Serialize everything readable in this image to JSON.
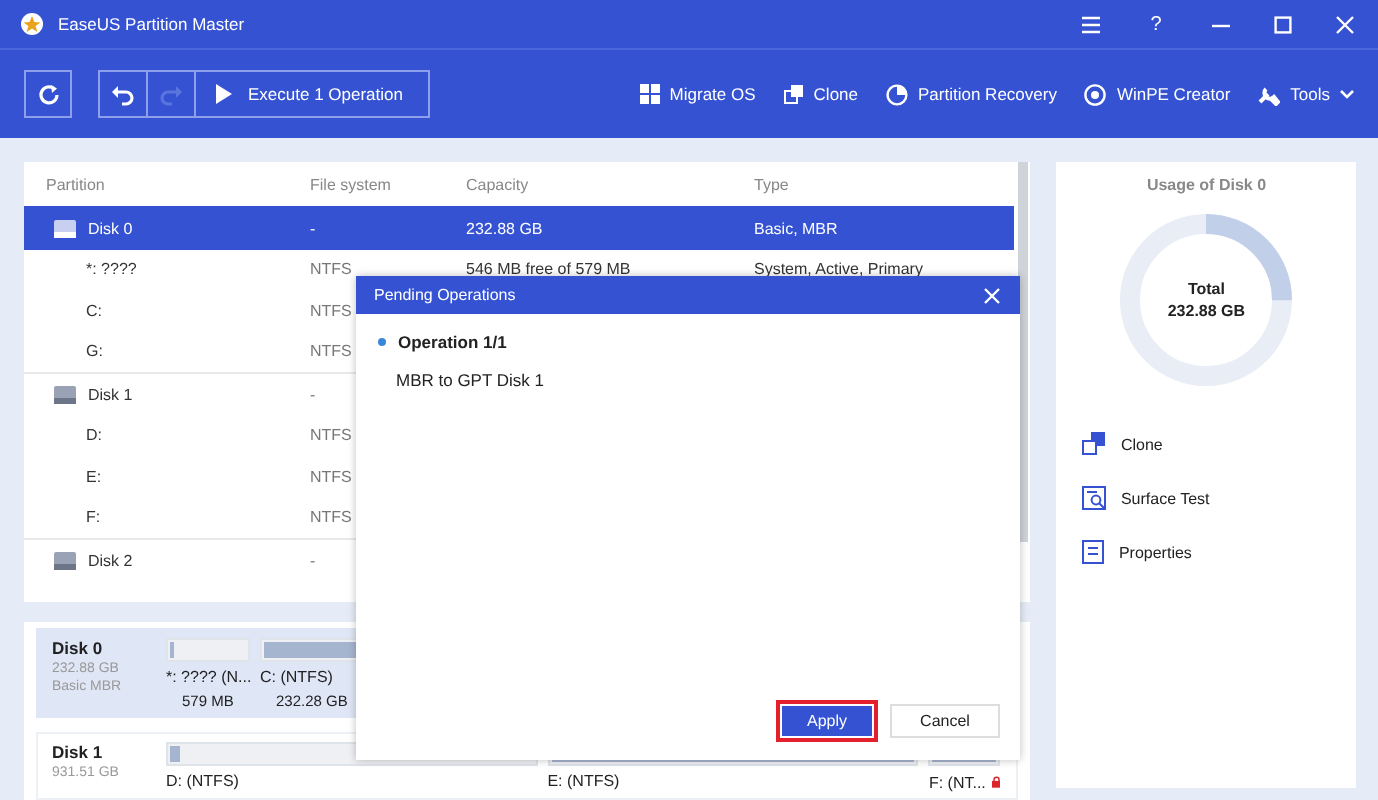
{
  "window": {
    "title": "EaseUS Partition Master",
    "help": "?"
  },
  "toolbar": {
    "execute_label": "Execute 1 Operation",
    "redo_disabled": true,
    "actions": [
      {
        "kind": "migrate",
        "label": "Migrate OS"
      },
      {
        "kind": "clone",
        "label": "Clone"
      },
      {
        "kind": "recovery",
        "label": "Partition Recovery"
      },
      {
        "kind": "winpe",
        "label": "WinPE Creator"
      },
      {
        "kind": "tools",
        "label": "Tools"
      }
    ]
  },
  "table": {
    "columns": [
      "Partition",
      "File system",
      "Capacity",
      "Type"
    ],
    "rows": [
      {
        "kind": "disk",
        "selected": true,
        "cells": [
          "Disk 0",
          "-",
          "232.88 GB",
          "Basic, MBR"
        ]
      },
      {
        "kind": "partition",
        "selected": false,
        "cells": [
          "*: ????",
          "NTFS",
          "546 MB free of 579 MB",
          "System, Active, Primary"
        ]
      },
      {
        "kind": "partition",
        "selected": false,
        "cells": [
          "C:",
          "NTFS"
        ]
      },
      {
        "kind": "partition",
        "selected": false,
        "cells": [
          "G:",
          "NTFS"
        ]
      },
      {
        "kind": "disk",
        "selected": false,
        "cells": [
          "Disk 1",
          "-"
        ]
      },
      {
        "kind": "partition",
        "selected": false,
        "cells": [
          "D:",
          "NTFS"
        ]
      },
      {
        "kind": "partition",
        "selected": false,
        "cells": [
          "E:",
          "NTFS"
        ]
      },
      {
        "kind": "partition",
        "selected": false,
        "cells": [
          "F:",
          "NTFS"
        ]
      },
      {
        "kind": "disk",
        "selected": false,
        "cells": [
          "Disk 2",
          "-"
        ]
      }
    ]
  },
  "disk_map": {
    "disks": [
      {
        "name": "Disk 0",
        "size": "232.88 GB",
        "type": "Basic MBR",
        "selected": true,
        "partitions": [
          {
            "label": "*: ???? (N...",
            "size": "579 MB",
            "level": 0.06
          },
          {
            "label": "C: (NTFS)",
            "size": "232.28 GB",
            "level": 1
          }
        ]
      },
      {
        "name": "Disk 1",
        "size": "931.51 GB",
        "selected": false,
        "partitions": [
          {
            "label": "D: (NTFS)",
            "level": 0.03
          },
          {
            "label": "E: (NTFS)",
            "level": 1
          },
          {
            "label": "F: (NT...",
            "level": 1,
            "locked": true
          }
        ]
      }
    ]
  },
  "side_panel": {
    "title": "Usage of Disk 0",
    "total_label": "Total",
    "total_value": "232.88 GB",
    "level": 0.25,
    "actions": [
      {
        "kind": "clone",
        "label": "Clone"
      },
      {
        "kind": "surface",
        "label": "Surface Test"
      },
      {
        "kind": "properties",
        "label": "Properties"
      }
    ]
  },
  "dialog": {
    "title": "Pending Operations",
    "operations": [
      {
        "heading": "Operation 1/1",
        "detail": "MBR to GPT Disk 1"
      }
    ],
    "buttons": [
      {
        "kind": "primary",
        "label": "Apply",
        "highlighted": true
      },
      {
        "kind": "secondary",
        "label": "Cancel",
        "highlighted": false
      }
    ]
  }
}
